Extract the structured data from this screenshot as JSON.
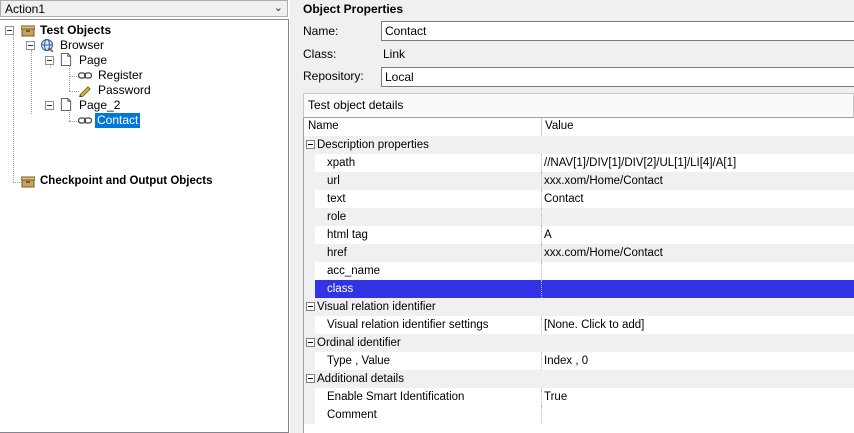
{
  "action_combo": {
    "value": "Action1"
  },
  "tree": {
    "root": "Test Objects",
    "browser": "Browser",
    "page": "Page",
    "register": "Register",
    "password": "Password",
    "page2": "Page_2",
    "contact": "Contact",
    "checkpoints": "Checkpoint and Output Objects"
  },
  "properties": {
    "title": "Object Properties",
    "name_label": "Name:",
    "name_value": "Contact",
    "class_label": "Class:",
    "class_value": "Link",
    "repository_label": "Repository:",
    "repository_value": "Local",
    "details_label": "Test object details"
  },
  "grid": {
    "col_name": "Name",
    "col_value": "Value",
    "categories": {
      "description": "Description properties",
      "visual": "Visual relation identifier",
      "ordinal": "Ordinal identifier",
      "additional": "Additional details"
    },
    "rows": {
      "xpath": {
        "name": "xpath",
        "value": "//NAV[1]/DIV[1]/DIV[2]/UL[1]/LI[4]/A[1]"
      },
      "url": {
        "name": "url",
        "value": "xxx.xom/Home/Contact"
      },
      "text": {
        "name": "text",
        "value": "Contact"
      },
      "role": {
        "name": "role",
        "value": ""
      },
      "html_tag": {
        "name": "html tag",
        "value": "A"
      },
      "href": {
        "name": "href",
        "value": "xxx.com/Home/Contact"
      },
      "acc_name": {
        "name": "acc_name",
        "value": ""
      },
      "class": {
        "name": "class",
        "value": ""
      },
      "visual_settings": {
        "name": "Visual relation identifier settings",
        "value": "[None. Click to add]"
      },
      "type_value": {
        "name": "Type , Value",
        "value": "Index , 0"
      },
      "smart_id": {
        "name": "Enable Smart Identification",
        "value": "True"
      },
      "comment": {
        "name": "Comment",
        "value": ""
      }
    }
  },
  "colors": {
    "selection_tree": "#0078d7",
    "selection_grid": "#3333e6",
    "panel_bg": "#f0f0f0"
  },
  "icons": {
    "root": "test-objects-icon",
    "browser": "browser-globe-icon",
    "page": "page-document-icon",
    "register": "link-icon",
    "password": "edit-pencil-icon",
    "contact": "link-icon",
    "checkpoints": "checkpoint-box-icon"
  }
}
